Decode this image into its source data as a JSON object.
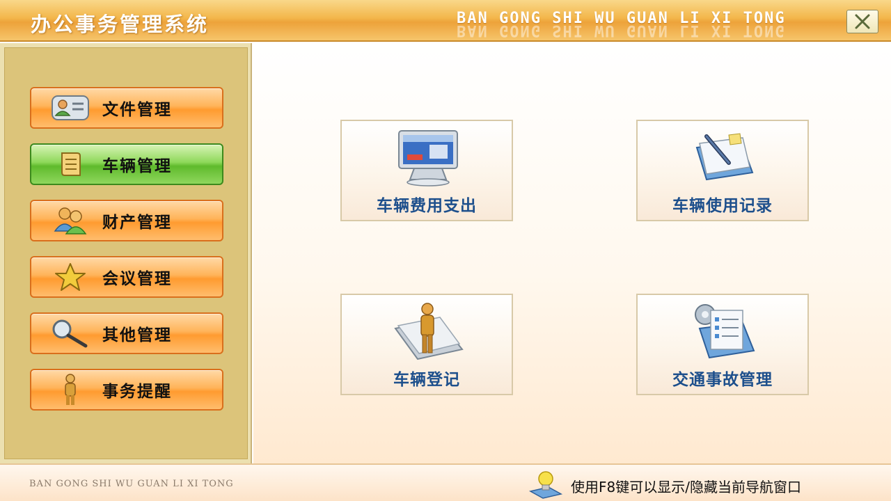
{
  "window": {
    "title": "办公事务管理系统",
    "pinyin_title": "BAN GONG SHI WU  GUAN LI XI TONG"
  },
  "sidebar": {
    "items": [
      {
        "label": "文件管理",
        "icon": "contact-card-icon",
        "active": false
      },
      {
        "label": "车辆管理",
        "icon": "document-icon",
        "active": true
      },
      {
        "label": "财产管理",
        "icon": "users-icon",
        "active": false
      },
      {
        "label": "会议管理",
        "icon": "star-icon",
        "active": false
      },
      {
        "label": "其他管理",
        "icon": "magnifier-icon",
        "active": false
      },
      {
        "label": "事务提醒",
        "icon": "person-icon",
        "active": false
      }
    ]
  },
  "main": {
    "tiles": [
      {
        "label": "车辆费用支出",
        "icon": "monitor-icon"
      },
      {
        "label": "车辆使用记录",
        "icon": "pen-notebook-icon"
      },
      {
        "label": "车辆登记",
        "icon": "person-document-icon"
      },
      {
        "label": "交通事故管理",
        "icon": "gear-checklist-icon"
      }
    ]
  },
  "footer": {
    "left_text": "BAN GONG SHI WU GUAN LI XI TONG",
    "hint": "使用F8键可以显示/隐藏当前导航窗口"
  },
  "colors": {
    "title_bar": "#eda23a",
    "nav_orange": "#ff9b30",
    "nav_active_green": "#5fba2c",
    "tile_label": "#1d4f8c",
    "sidebar_bg": "#dcc47a"
  }
}
